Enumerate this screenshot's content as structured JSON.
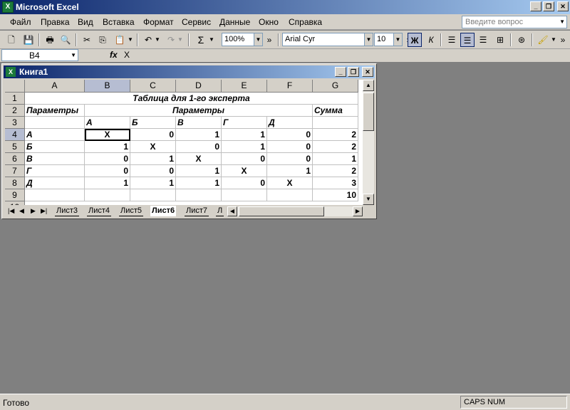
{
  "app": {
    "title": "Microsoft Excel",
    "icon": "excel-icon"
  },
  "window_controls": {
    "minimize": "_",
    "restore": "❐",
    "close": "✕"
  },
  "menu": [
    "Файл",
    "Правка",
    "Вид",
    "Вставка",
    "Формат",
    "Сервис",
    "Данные",
    "Окно",
    "Справка"
  ],
  "help": {
    "placeholder": "Введите вопрос"
  },
  "toolbar": {
    "zoom": "100%",
    "font": "Arial Cyr",
    "size": "10",
    "bold": "Ж",
    "italic": "К",
    "sum": "Σ"
  },
  "formula_bar": {
    "cell_ref": "B4",
    "fx": "fx",
    "value": "X"
  },
  "workbook": {
    "title": "Книга1",
    "columns": [
      "A",
      "B",
      "C",
      "D",
      "E",
      "F",
      "G"
    ],
    "rows": [
      "1",
      "2",
      "3",
      "4",
      "5",
      "6",
      "7",
      "8",
      "9",
      "10"
    ],
    "cells": {
      "r1_title": "Таблица для 1-го эксперта",
      "r2_a": "Параметры",
      "r2_mid": "Параметры",
      "r2_g": "Сумма",
      "r3": [
        "А",
        "Б",
        "В",
        "Г",
        "Д"
      ],
      "data": [
        {
          "label": "А",
          "vals": [
            "X",
            "0",
            "1",
            "1",
            "0"
          ],
          "sum": "2"
        },
        {
          "label": "Б",
          "vals": [
            "1",
            "X",
            "0",
            "1",
            "0"
          ],
          "sum": "2"
        },
        {
          "label": "В",
          "vals": [
            "0",
            "1",
            "X",
            "0",
            "0"
          ],
          "sum": "1"
        },
        {
          "label": "Г",
          "vals": [
            "0",
            "0",
            "1",
            "X",
            "1"
          ],
          "sum": "2"
        },
        {
          "label": "Д",
          "vals": [
            "1",
            "1",
            "1",
            "0",
            "X"
          ],
          "sum": "3"
        }
      ],
      "r9_sum": "10"
    },
    "sheets": [
      "Лист3",
      "Лист4",
      "Лист5",
      "Лист6",
      "Лист7",
      "Л"
    ],
    "active_sheet": "Лист6"
  },
  "status": {
    "ready": "Готово",
    "indicators": "CAPS NUM"
  }
}
